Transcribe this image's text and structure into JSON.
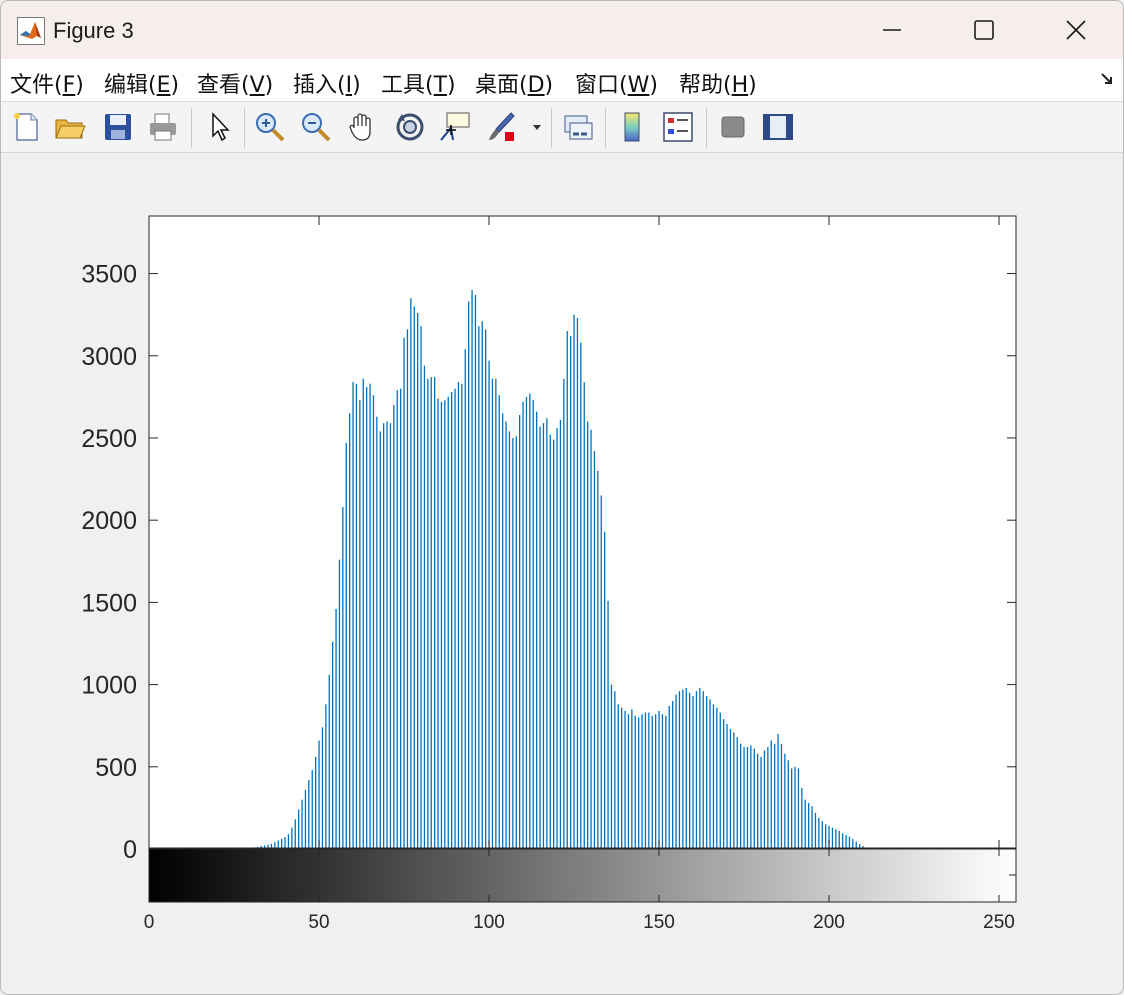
{
  "window": {
    "title": "Figure 3",
    "title_icon": "matlab-logo-icon"
  },
  "menu": [
    {
      "label": "文件(",
      "key": "F",
      "tail": ")"
    },
    {
      "label": "编辑(",
      "key": "E",
      "tail": ")"
    },
    {
      "label": "查看(",
      "key": "V",
      "tail": ")"
    },
    {
      "label": "插入(",
      "key": "I",
      "tail": ")"
    },
    {
      "label": "工具(",
      "key": "T",
      "tail": ")"
    },
    {
      "label": "桌面(",
      "key": "D",
      "tail": ")"
    },
    {
      "label": "窗口(",
      "key": "W",
      "tail": ")"
    },
    {
      "label": "帮助(",
      "key": "H",
      "tail": ")"
    }
  ],
  "toolbar_icons": [
    "new-figure-icon",
    "open-file-icon",
    "save-icon",
    "print-icon",
    "edit-plot-arrow-icon",
    "zoom-in-icon",
    "zoom-out-icon",
    "pan-hand-icon",
    "rotate-3d-icon",
    "data-cursor-icon",
    "brush-icon",
    "link-plot-icon",
    "colorbar-icon",
    "legend-icon",
    "hide-plot-tools-icon",
    "show-plot-tools-icon"
  ],
  "colors": {
    "bar": "#0072bd",
    "axes_bg": "#ffffff",
    "figure_bg": "#f0f0f0"
  },
  "chart_data": {
    "type": "bar",
    "title": "",
    "xlabel": "",
    "ylabel": "",
    "xlim": [
      0,
      255
    ],
    "ylim": [
      0,
      3850
    ],
    "colorbar": "gray",
    "grid": false,
    "yticks": [
      0,
      500,
      1000,
      1500,
      2000,
      2500,
      3000,
      3500
    ],
    "xticks": [
      0,
      50,
      100,
      150,
      200,
      250
    ],
    "ytick_labels": [
      "0",
      "500",
      "1000",
      "1500",
      "2000",
      "2500",
      "3000",
      "3500"
    ],
    "xtick_labels": [
      "0",
      "50",
      "100",
      "150",
      "200",
      "250"
    ],
    "x_start": 0,
    "values": [
      0,
      0,
      0,
      0,
      0,
      0,
      0,
      0,
      0,
      0,
      0,
      0,
      0,
      0,
      0,
      0,
      0,
      0,
      0,
      0,
      0,
      0,
      0,
      2,
      3,
      3,
      4,
      5,
      5,
      6,
      8,
      10,
      13,
      18,
      22,
      27,
      32,
      42,
      52,
      62,
      72,
      90,
      130,
      180,
      240,
      300,
      360,
      420,
      480,
      560,
      660,
      740,
      880,
      1060,
      1260,
      1460,
      1760,
      2080,
      2470,
      2650,
      2840,
      2830,
      2730,
      2860,
      2810,
      2830,
      2760,
      2630,
      2540,
      2590,
      2600,
      2590,
      2700,
      2790,
      2800,
      3110,
      3160,
      3350,
      3300,
      3260,
      3180,
      2940,
      2860,
      2870,
      2870,
      2740,
      2720,
      2730,
      2750,
      2780,
      2800,
      2840,
      2830,
      3040,
      3330,
      3400,
      3370,
      3180,
      3210,
      3160,
      2970,
      2860,
      2860,
      2760,
      2650,
      2600,
      2540,
      2500,
      2510,
      2640,
      2720,
      2750,
      2770,
      2730,
      2660,
      2570,
      2590,
      2620,
      2520,
      2490,
      2560,
      2610,
      2860,
      3150,
      3120,
      3250,
      3230,
      3080,
      2840,
      2600,
      2550,
      2420,
      2300,
      2150,
      1930,
      1510,
      1000,
      960,
      880,
      860,
      840,
      820,
      850,
      810,
      800,
      820,
      830,
      830,
      810,
      820,
      840,
      820,
      810,
      870,
      900,
      940,
      960,
      970,
      980,
      950,
      930,
      960,
      980,
      960,
      930,
      910,
      880,
      860,
      830,
      790,
      760,
      730,
      710,
      680,
      640,
      620,
      620,
      630,
      610,
      580,
      560,
      600,
      620,
      660,
      640,
      700,
      640,
      580,
      540,
      490,
      500,
      490,
      370,
      300,
      280,
      260,
      220,
      190,
      170,
      150,
      140,
      130,
      120,
      110,
      95,
      85,
      75,
      60,
      45,
      30,
      18,
      10,
      6,
      4,
      3,
      2,
      2,
      1,
      0,
      0,
      0,
      0,
      0,
      0,
      0,
      0,
      0,
      0,
      0,
      0,
      0,
      0,
      0,
      0,
      0,
      0,
      0,
      0,
      0,
      0,
      0,
      0,
      0,
      0,
      0,
      0,
      0,
      0,
      0,
      0,
      0,
      0,
      0,
      0,
      0,
      0,
      0,
      0
    ]
  }
}
